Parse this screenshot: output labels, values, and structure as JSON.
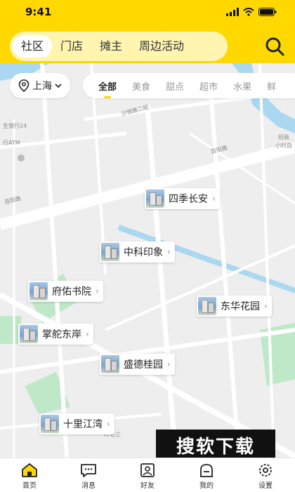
{
  "status_bar": {
    "time": "9:41"
  },
  "top_tabs": [
    {
      "label": "社区",
      "active": true
    },
    {
      "label": "门店",
      "active": false
    },
    {
      "label": "摊主",
      "active": false
    },
    {
      "label": "周边活动",
      "active": false
    }
  ],
  "search_icon": "search-icon",
  "city_selector": {
    "label": "上海",
    "icon": "location-pin-icon"
  },
  "categories": [
    {
      "label": "全部",
      "active": true
    },
    {
      "label": "美食"
    },
    {
      "label": "甜点"
    },
    {
      "label": "超市"
    },
    {
      "label": "水果"
    },
    {
      "label": "鲜"
    }
  ],
  "map_labels": {
    "road1": "百阳路",
    "road2": "百阳路",
    "bank": "生银行24",
    "atm": "行ATM",
    "road3": "沙锦路二组",
    "road4": "叶老三",
    "road5": "招商",
    "road6": "小时自"
  },
  "communities": [
    {
      "name": "四季长安"
    },
    {
      "name": "中科印象"
    },
    {
      "name": "府佑书院"
    },
    {
      "name": "东华花园"
    },
    {
      "name": "掌舵东岸"
    },
    {
      "name": "盛德桂园"
    },
    {
      "name": "十里江湾"
    }
  ],
  "watermark": "搜软下载",
  "tabbar": [
    {
      "label": "首页",
      "icon": "home-icon",
      "active": true
    },
    {
      "label": "消息",
      "icon": "message-icon"
    },
    {
      "label": "好友",
      "icon": "friends-icon"
    },
    {
      "label": "我的",
      "icon": "profile-icon"
    },
    {
      "label": "设置",
      "icon": "settings-icon"
    }
  ],
  "colors": {
    "accent": "#ffd800",
    "water": "#a9d8f0",
    "park": "#bfe8c8"
  }
}
